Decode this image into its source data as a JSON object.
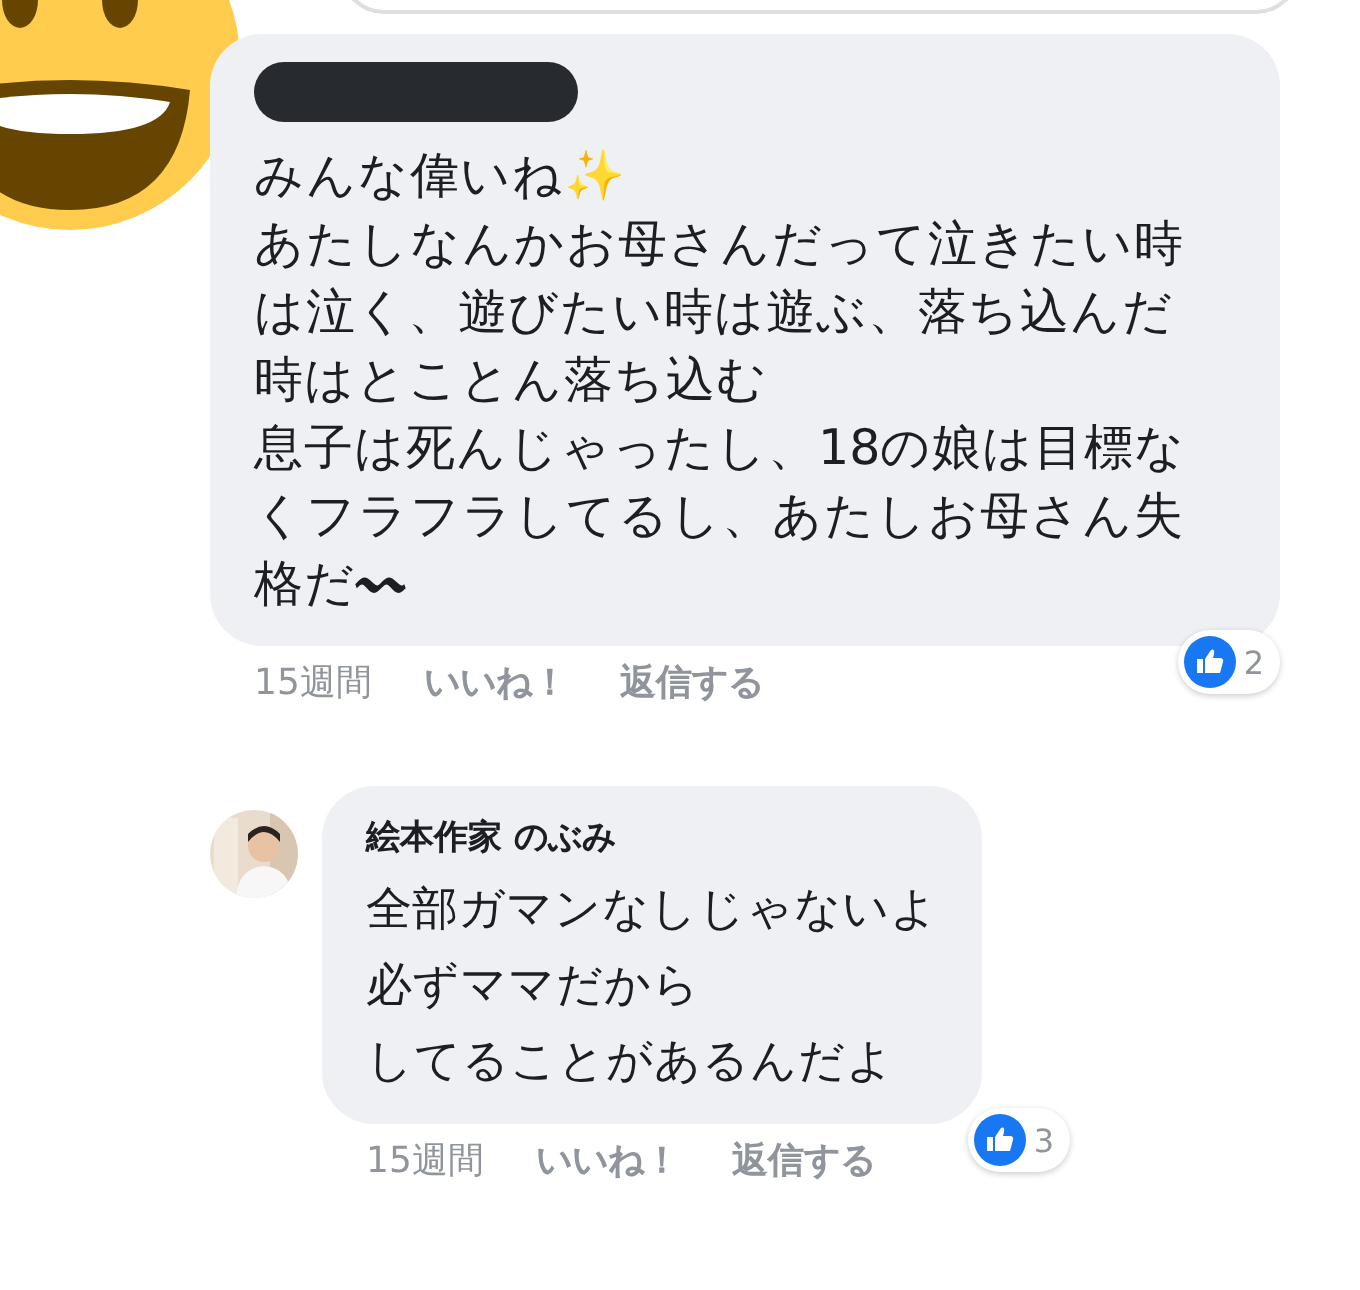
{
  "comments": [
    {
      "author_hidden": true,
      "lines": [
        "みんな偉いね✨",
        "あたしなんかお母さんだって泣きたい時",
        "は泣く、遊びたい時は遊ぶ、落ち込んだ",
        "時はとことん落ち込む",
        "息子は死んじゃったし、18の娘は目標な",
        "くフラフラしてるし、あたしお母さん失",
        "格だ〰"
      ],
      "time": "15週間",
      "like": "いいね！",
      "reply": "返信する",
      "reactions": "2"
    },
    {
      "author_hidden": false,
      "author": "絵本作家 のぶみ",
      "lines": [
        "全部ガマンなしじゃないよ",
        "必ずママだから",
        "してることがあるんだよ"
      ],
      "time": "15週間",
      "like": "いいね！",
      "reply": "返信する",
      "reactions": "3"
    }
  ]
}
